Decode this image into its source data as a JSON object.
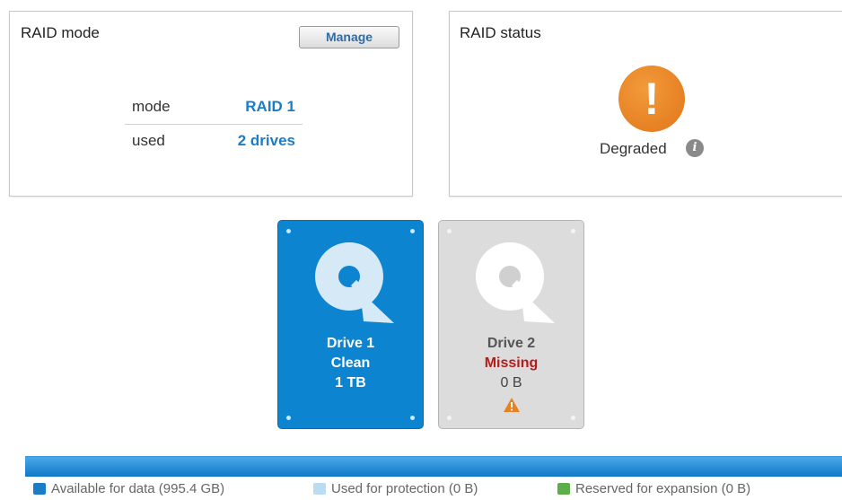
{
  "raid_mode_panel": {
    "title": "RAID mode",
    "manage_label": "Manage",
    "rows": [
      {
        "key": "mode",
        "value": "RAID 1"
      },
      {
        "key": "used",
        "value": "2 drives"
      }
    ]
  },
  "raid_status_panel": {
    "title": "RAID status",
    "status_icon": "!",
    "status_text": "Degraded",
    "info_icon": "i",
    "status_color": "#e8821f"
  },
  "drives": [
    {
      "name": "Drive 1",
      "status": "Clean",
      "size": "1 TB",
      "color": "#0d84d0"
    },
    {
      "name": "Drive 2",
      "status": "Missing",
      "size": "0 B",
      "color": "#dcdcdc",
      "warning": true
    }
  ],
  "capacity": {
    "bar_color": "#1079c8",
    "legend": [
      {
        "label": "Available for data (995.4 GB)",
        "color": "#1a7dc8"
      },
      {
        "label": "Used for protection (0 B)",
        "color": "#bcdcf2"
      },
      {
        "label": "Reserved for expansion (0 B)",
        "color": "#5cae4a"
      }
    ]
  }
}
